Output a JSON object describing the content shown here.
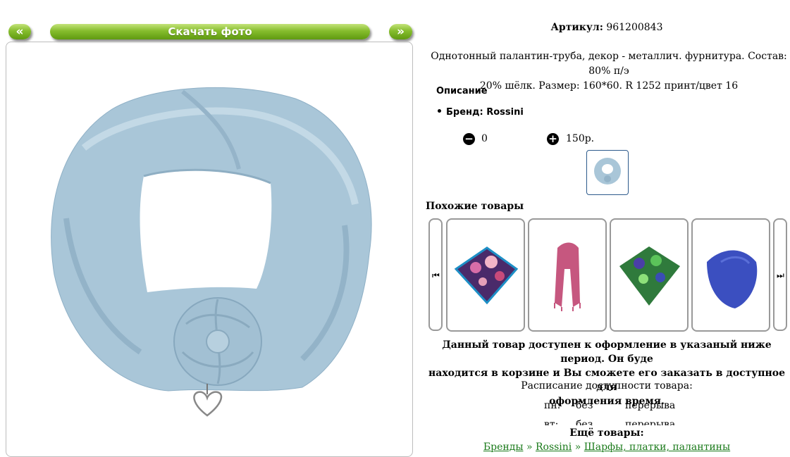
{
  "nav": {
    "prev_label": "«",
    "download_label": "Скачать фото",
    "next_label": "»"
  },
  "product": {
    "article_label": "Артикул:",
    "article_value": "961200843",
    "description_line1": "Однотонный палантин-труба, декор - металлич. фурнитура. Состав: 80% п/э",
    "description_line2": "20% шёлк. Размер: 160*60. R 1252 принт/цвет 16",
    "section_title": "Описание",
    "brand": "Бренд: Rossini",
    "quantity": "0",
    "price": "150р."
  },
  "similar": {
    "title": "Похожие товары",
    "items": [
      {
        "icon": "floral-square-scarf"
      },
      {
        "icon": "pink-long-scarf"
      },
      {
        "icon": "green-floral-square-scarf"
      },
      {
        "icon": "blue-scarf"
      }
    ]
  },
  "availability": {
    "message_line1": "Данный товар доступен к оформление в указаный ниже период. Он буде",
    "message_line2": "находится в корзине и Вы сможете его заказать в доступное для",
    "message_line3": "оформления время.",
    "schedule_title": "Расписание доступности товара:",
    "schedule": [
      {
        "day": "пн:",
        "from": "без",
        "to": "перерыва"
      },
      {
        "day": "вт:",
        "from": "без",
        "to": "перерыва"
      }
    ]
  },
  "more": {
    "title": "Ещё товары:",
    "breadcrumbs": [
      "Бренды",
      "Rossini",
      "Шарфы, платки, палантины"
    ],
    "separator": "»"
  },
  "colors": {
    "button_green": "#7ab424",
    "scarf_blue": "#a9c6d8",
    "link_green": "#1a7a1a"
  }
}
